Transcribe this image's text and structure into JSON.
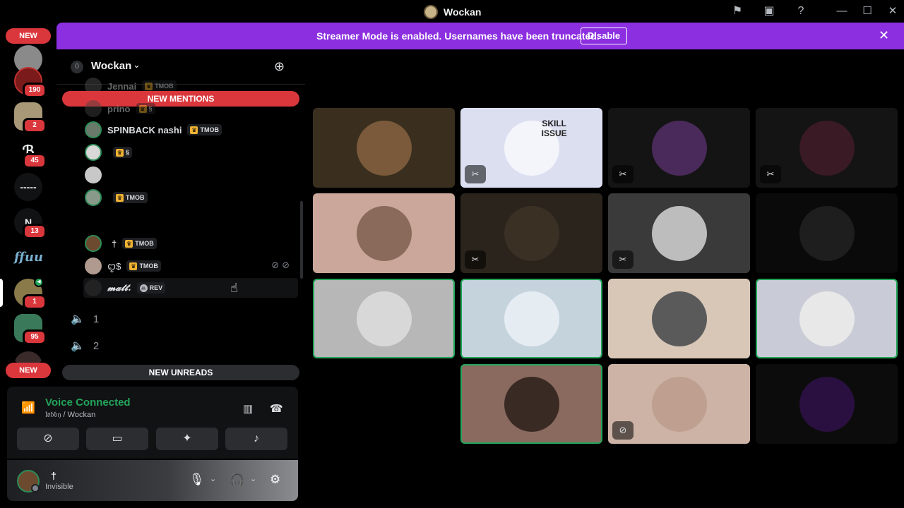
{
  "app": {
    "title": "Wockan"
  },
  "banner": {
    "message": "Streamer Mode is enabled. Usernames have been truncated.",
    "disable_label": "Disable",
    "color": "#8c2fe0"
  },
  "rail": {
    "new_top": "NEW",
    "new_bottom": "NEW",
    "servers": [
      {
        "badge": "190"
      },
      {
        "badge": "2"
      },
      {
        "badge": "45"
      },
      {
        "label": "-----"
      },
      {
        "label": "N",
        "badge": "13"
      },
      {
        "label": "ffuu"
      },
      {
        "badge": "1"
      },
      {
        "badge": "95"
      }
    ]
  },
  "sidebar": {
    "server_name": "Wockan",
    "new_mentions": "NEW MENTIONS",
    "new_unreads": "NEW UNREADS",
    "members": [
      {
        "name": "Jennai",
        "tag": "TMOB"
      },
      {
        "name": "prino",
        "tag": "§"
      },
      {
        "name": "SPINBACK nashi",
        "tag": "TMOB"
      },
      {
        "name": "",
        "tag": "§"
      },
      {
        "name": "",
        "tag": ""
      },
      {
        "name": "",
        "tag": "TMOB"
      },
      {
        "name": "†",
        "tag": "TMOB"
      },
      {
        "name": "ꨄ$",
        "tag": "TMOB"
      },
      {
        "name": "𝓶𝓪𝓽𝓽.",
        "tag": "REV"
      }
    ],
    "voice_channels": [
      {
        "label": "1"
      },
      {
        "label": "2"
      }
    ]
  },
  "voice": {
    "title": "Voice Connected",
    "subtitle": "𝔩𝔬𝔟𝔟𝔶 / Wockan",
    "status_color": "#23a55a"
  },
  "user": {
    "name": "†",
    "status": "Invisible"
  },
  "grid": {
    "tiles": [
      {
        "bg": "#3a2f1e",
        "av": "#7a5a3a",
        "muted": false,
        "speaking": false
      },
      {
        "bg": "#dcdff0",
        "av": "#f4f5fb",
        "muted": true,
        "speaking": false,
        "text": "SKILL ISSUE"
      },
      {
        "bg": "#141414",
        "av": "#4a2a5a",
        "muted": true,
        "speaking": false
      },
      {
        "bg": "#141414",
        "av": "#3a1a24",
        "muted": true,
        "speaking": false
      },
      {
        "bg": "#caa79a",
        "av": "#8a6a5a",
        "muted": false,
        "speaking": false
      },
      {
        "bg": "#2a241c",
        "av": "#3a3024",
        "muted": true,
        "speaking": false
      },
      {
        "bg": "#3a3a3a",
        "av": "#bdbdbd",
        "muted": true,
        "speaking": false
      },
      {
        "bg": "#0a0a0a",
        "av": "#1e1e1e",
        "muted": false,
        "speaking": false
      },
      {
        "bg": "#b7b7b7",
        "av": "#d8d8d8",
        "muted": false,
        "speaking": true
      },
      {
        "bg": "#c5d3dd",
        "av": "#e6edf2",
        "muted": false,
        "speaking": true
      },
      {
        "bg": "#d8c7b7",
        "av": "#5a5a5a",
        "muted": false,
        "speaking": false
      },
      {
        "bg": "#c9ccd6",
        "av": "#e8e8e8",
        "muted": false,
        "speaking": true
      },
      {
        "bg": "#8a6a5f",
        "av": "#3a2a24",
        "muted": false,
        "speaking": true
      },
      {
        "bg": "#cdb3a6",
        "av": "#bfa090",
        "muted": false,
        "speaking": false,
        "no_video": true
      },
      {
        "bg": "#0c0c0c",
        "av": "#2a1040",
        "muted": false,
        "speaking": false
      }
    ]
  }
}
